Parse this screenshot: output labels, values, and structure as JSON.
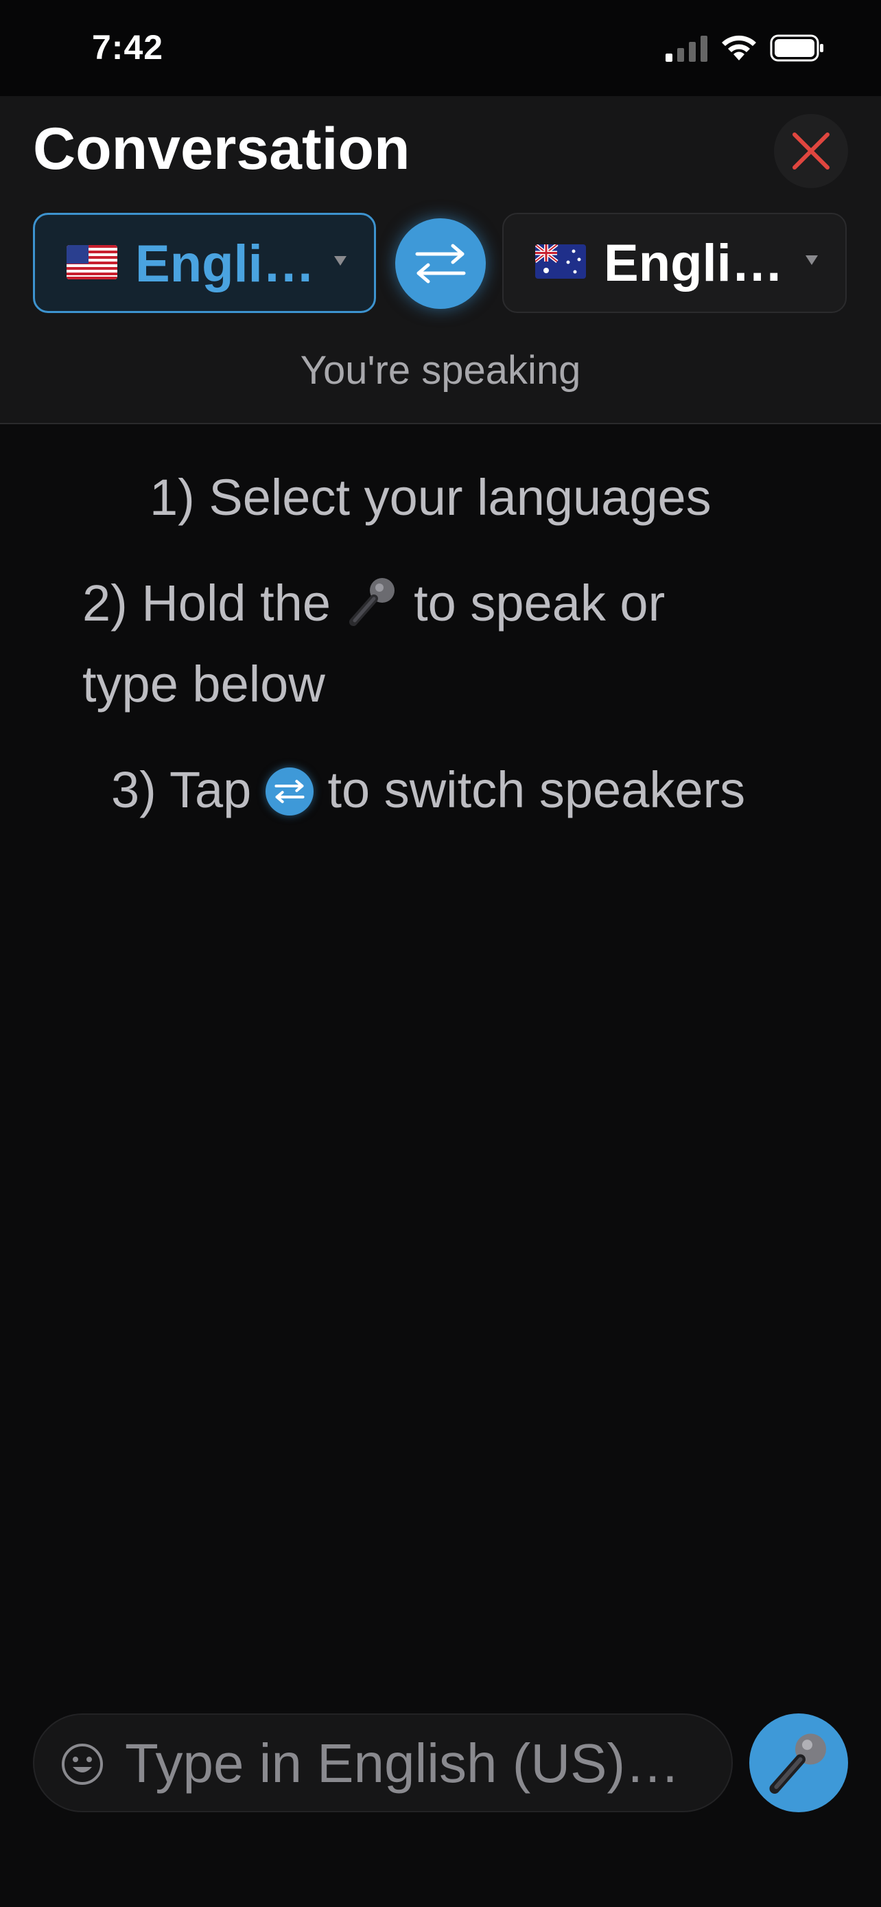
{
  "status": {
    "time": "7:42"
  },
  "header": {
    "title": "Conversation",
    "source_lang": {
      "label": "Engli…",
      "flag": "us-flag"
    },
    "target_lang": {
      "label": "Engli…",
      "flag": "au-flag"
    },
    "speaking_label": "You're speaking"
  },
  "instructions": {
    "step1": "1) Select your languages",
    "step2_before": "2) Hold the",
    "step2_after": "to speak or",
    "step2_line2": "type below",
    "step3_before": "3) Tap",
    "step3_after": "to switch speakers"
  },
  "input": {
    "placeholder": "Type in English (US)…"
  },
  "colors": {
    "accent": "#3e99d8",
    "close": "#e0463f",
    "background": "#0b0b0c",
    "panel": "#161617"
  }
}
